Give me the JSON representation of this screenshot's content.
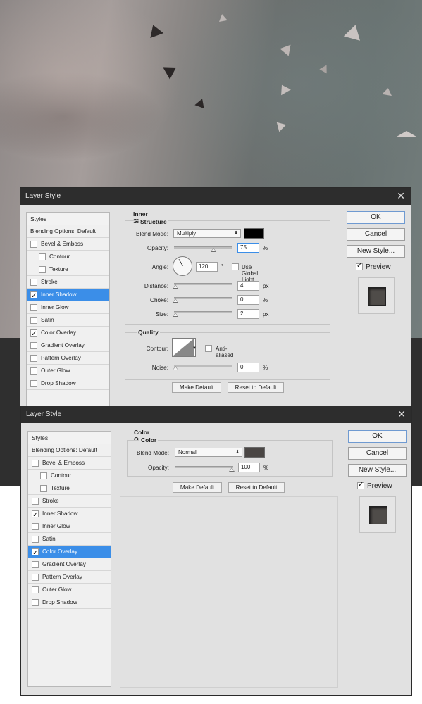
{
  "dialog1": {
    "title": "Layer Style",
    "styles_header": "Styles",
    "styles": [
      {
        "label": "Blending Options: Default",
        "checkbox": false,
        "checked": false,
        "selected": false
      },
      {
        "label": "Bevel & Emboss",
        "checkbox": true,
        "checked": false,
        "selected": false
      },
      {
        "label": "Contour",
        "checkbox": true,
        "checked": false,
        "selected": false,
        "sub": true
      },
      {
        "label": "Texture",
        "checkbox": true,
        "checked": false,
        "selected": false,
        "sub": true
      },
      {
        "label": "Stroke",
        "checkbox": true,
        "checked": false,
        "selected": false
      },
      {
        "label": "Inner Shadow",
        "checkbox": true,
        "checked": true,
        "selected": true
      },
      {
        "label": "Inner Glow",
        "checkbox": true,
        "checked": false,
        "selected": false
      },
      {
        "label": "Satin",
        "checkbox": true,
        "checked": false,
        "selected": false
      },
      {
        "label": "Color Overlay",
        "checkbox": true,
        "checked": true,
        "selected": false
      },
      {
        "label": "Gradient Overlay",
        "checkbox": true,
        "checked": false,
        "selected": false
      },
      {
        "label": "Pattern Overlay",
        "checkbox": true,
        "checked": false,
        "selected": false
      },
      {
        "label": "Outer Glow",
        "checkbox": true,
        "checked": false,
        "selected": false
      },
      {
        "label": "Drop Shadow",
        "checkbox": true,
        "checked": false,
        "selected": false
      }
    ],
    "section_title": "Inner Shadow",
    "structure_title": "Structure",
    "blend_mode_label": "Blend Mode:",
    "blend_mode_value": "Multiply",
    "blend_color": "#000000",
    "opacity_label": "Opacity:",
    "opacity_value": "75",
    "opacity_unit": "%",
    "angle_label": "Angle:",
    "angle_value": "120",
    "angle_unit": "°",
    "global_light_label": "Use Global Light",
    "distance_label": "Distance:",
    "distance_value": "4",
    "distance_unit": "px",
    "choke_label": "Choke:",
    "choke_value": "0",
    "choke_unit": "%",
    "size_label": "Size:",
    "size_value": "2",
    "size_unit": "px",
    "quality_title": "Quality",
    "contour_label": "Contour:",
    "anti_aliased_label": "Anti-aliased",
    "noise_label": "Noise:",
    "noise_value": "0",
    "noise_unit": "%",
    "make_default": "Make Default",
    "reset_default": "Reset to Default",
    "ok": "OK",
    "cancel": "Cancel",
    "new_style": "New Style...",
    "preview_label": "Preview",
    "preview_checked": true
  },
  "dialog2": {
    "title": "Layer Style",
    "styles_header": "Styles",
    "styles": [
      {
        "label": "Blending Options: Default",
        "checkbox": false,
        "checked": false,
        "selected": false
      },
      {
        "label": "Bevel & Emboss",
        "checkbox": true,
        "checked": false,
        "selected": false
      },
      {
        "label": "Contour",
        "checkbox": true,
        "checked": false,
        "selected": false,
        "sub": true
      },
      {
        "label": "Texture",
        "checkbox": true,
        "checked": false,
        "selected": false,
        "sub": true
      },
      {
        "label": "Stroke",
        "checkbox": true,
        "checked": false,
        "selected": false
      },
      {
        "label": "Inner Shadow",
        "checkbox": true,
        "checked": true,
        "selected": false
      },
      {
        "label": "Inner Glow",
        "checkbox": true,
        "checked": false,
        "selected": false
      },
      {
        "label": "Satin",
        "checkbox": true,
        "checked": false,
        "selected": false
      },
      {
        "label": "Color Overlay",
        "checkbox": true,
        "checked": true,
        "selected": true
      },
      {
        "label": "Gradient Overlay",
        "checkbox": true,
        "checked": false,
        "selected": false
      },
      {
        "label": "Pattern Overlay",
        "checkbox": true,
        "checked": false,
        "selected": false
      },
      {
        "label": "Outer Glow",
        "checkbox": true,
        "checked": false,
        "selected": false
      },
      {
        "label": "Drop Shadow",
        "checkbox": true,
        "checked": false,
        "selected": false
      }
    ],
    "section_title": "Color Overlay",
    "color_title": "Color",
    "blend_mode_label": "Blend Mode:",
    "blend_mode_value": "Normal",
    "blend_color": "#4a4644",
    "opacity_label": "Opacity:",
    "opacity_value": "100",
    "opacity_unit": "%",
    "make_default": "Make Default",
    "reset_default": "Reset to Default",
    "ok": "OK",
    "cancel": "Cancel",
    "new_style": "New Style...",
    "preview_label": "Preview",
    "preview_checked": true
  },
  "colors": {
    "selection": "#3b8ee8",
    "titlebar": "#2d2d2d",
    "dialog_bg": "#e1e1e1"
  }
}
